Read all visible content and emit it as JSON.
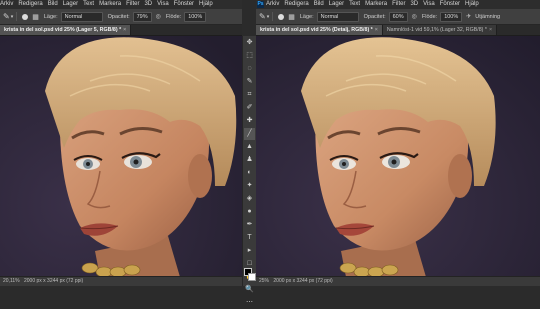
{
  "left": {
    "menu": [
      "Arkiv",
      "Redigera",
      "Bild",
      "Lager",
      "Text",
      "Markera",
      "Filter",
      "3D",
      "Visa",
      "Fönster",
      "Hjälp"
    ],
    "options": {
      "mode_label": "Läge:",
      "mode_value": "Normal",
      "opacity_label": "Opacitet:",
      "opacity_value": "79%",
      "flow_label": "Flöde:",
      "flow_value": "100%"
    },
    "tab": {
      "label": "krista in del sol.psd vid 25% (Lager 5, RGB/8) *",
      "close": "×"
    },
    "status": {
      "zoom": "20,11%",
      "docsize": "2000 px x 3244 px (72 ppi)"
    }
  },
  "right": {
    "app_mark": "Ps",
    "menu": [
      "Arkiv",
      "Redigera",
      "Bild",
      "Lager",
      "Text",
      "Markera",
      "Filter",
      "3D",
      "Visa",
      "Fönster",
      "Hjälp"
    ],
    "options": {
      "mode_label": "Läge:",
      "mode_value": "Normal",
      "opacity_label": "Opacitet:",
      "opacity_value": "60%",
      "flow_label": "Flöde:",
      "flow_value": "100%",
      "smoothing": "Utjämning"
    },
    "tabs": [
      {
        "label": "krista in del sol.psd vid 25% (Detalj, RGB/8) *",
        "close": "×"
      },
      {
        "label": "Namnlöst-1 vid 59,1% (Lager 32, RGB/8) *",
        "close": "×"
      }
    ],
    "status": {
      "zoom": "25%",
      "docsize": "2000 px x 3244 px (72 ppi)"
    }
  },
  "toolbar": {
    "tools": [
      "✥",
      "⬚",
      "◌",
      "✎",
      "⌗",
      "✐",
      "✚",
      "╱",
      "▲",
      "♟",
      "◐",
      "✦",
      "◈",
      "●",
      "✒",
      "T",
      "▸",
      "□",
      "✋",
      "🔍",
      "⋯"
    ]
  },
  "colors": {
    "background": "#2a2536",
    "skin": "#c98d6a",
    "hair": "#c9a474",
    "accent": "#31a8ff"
  }
}
